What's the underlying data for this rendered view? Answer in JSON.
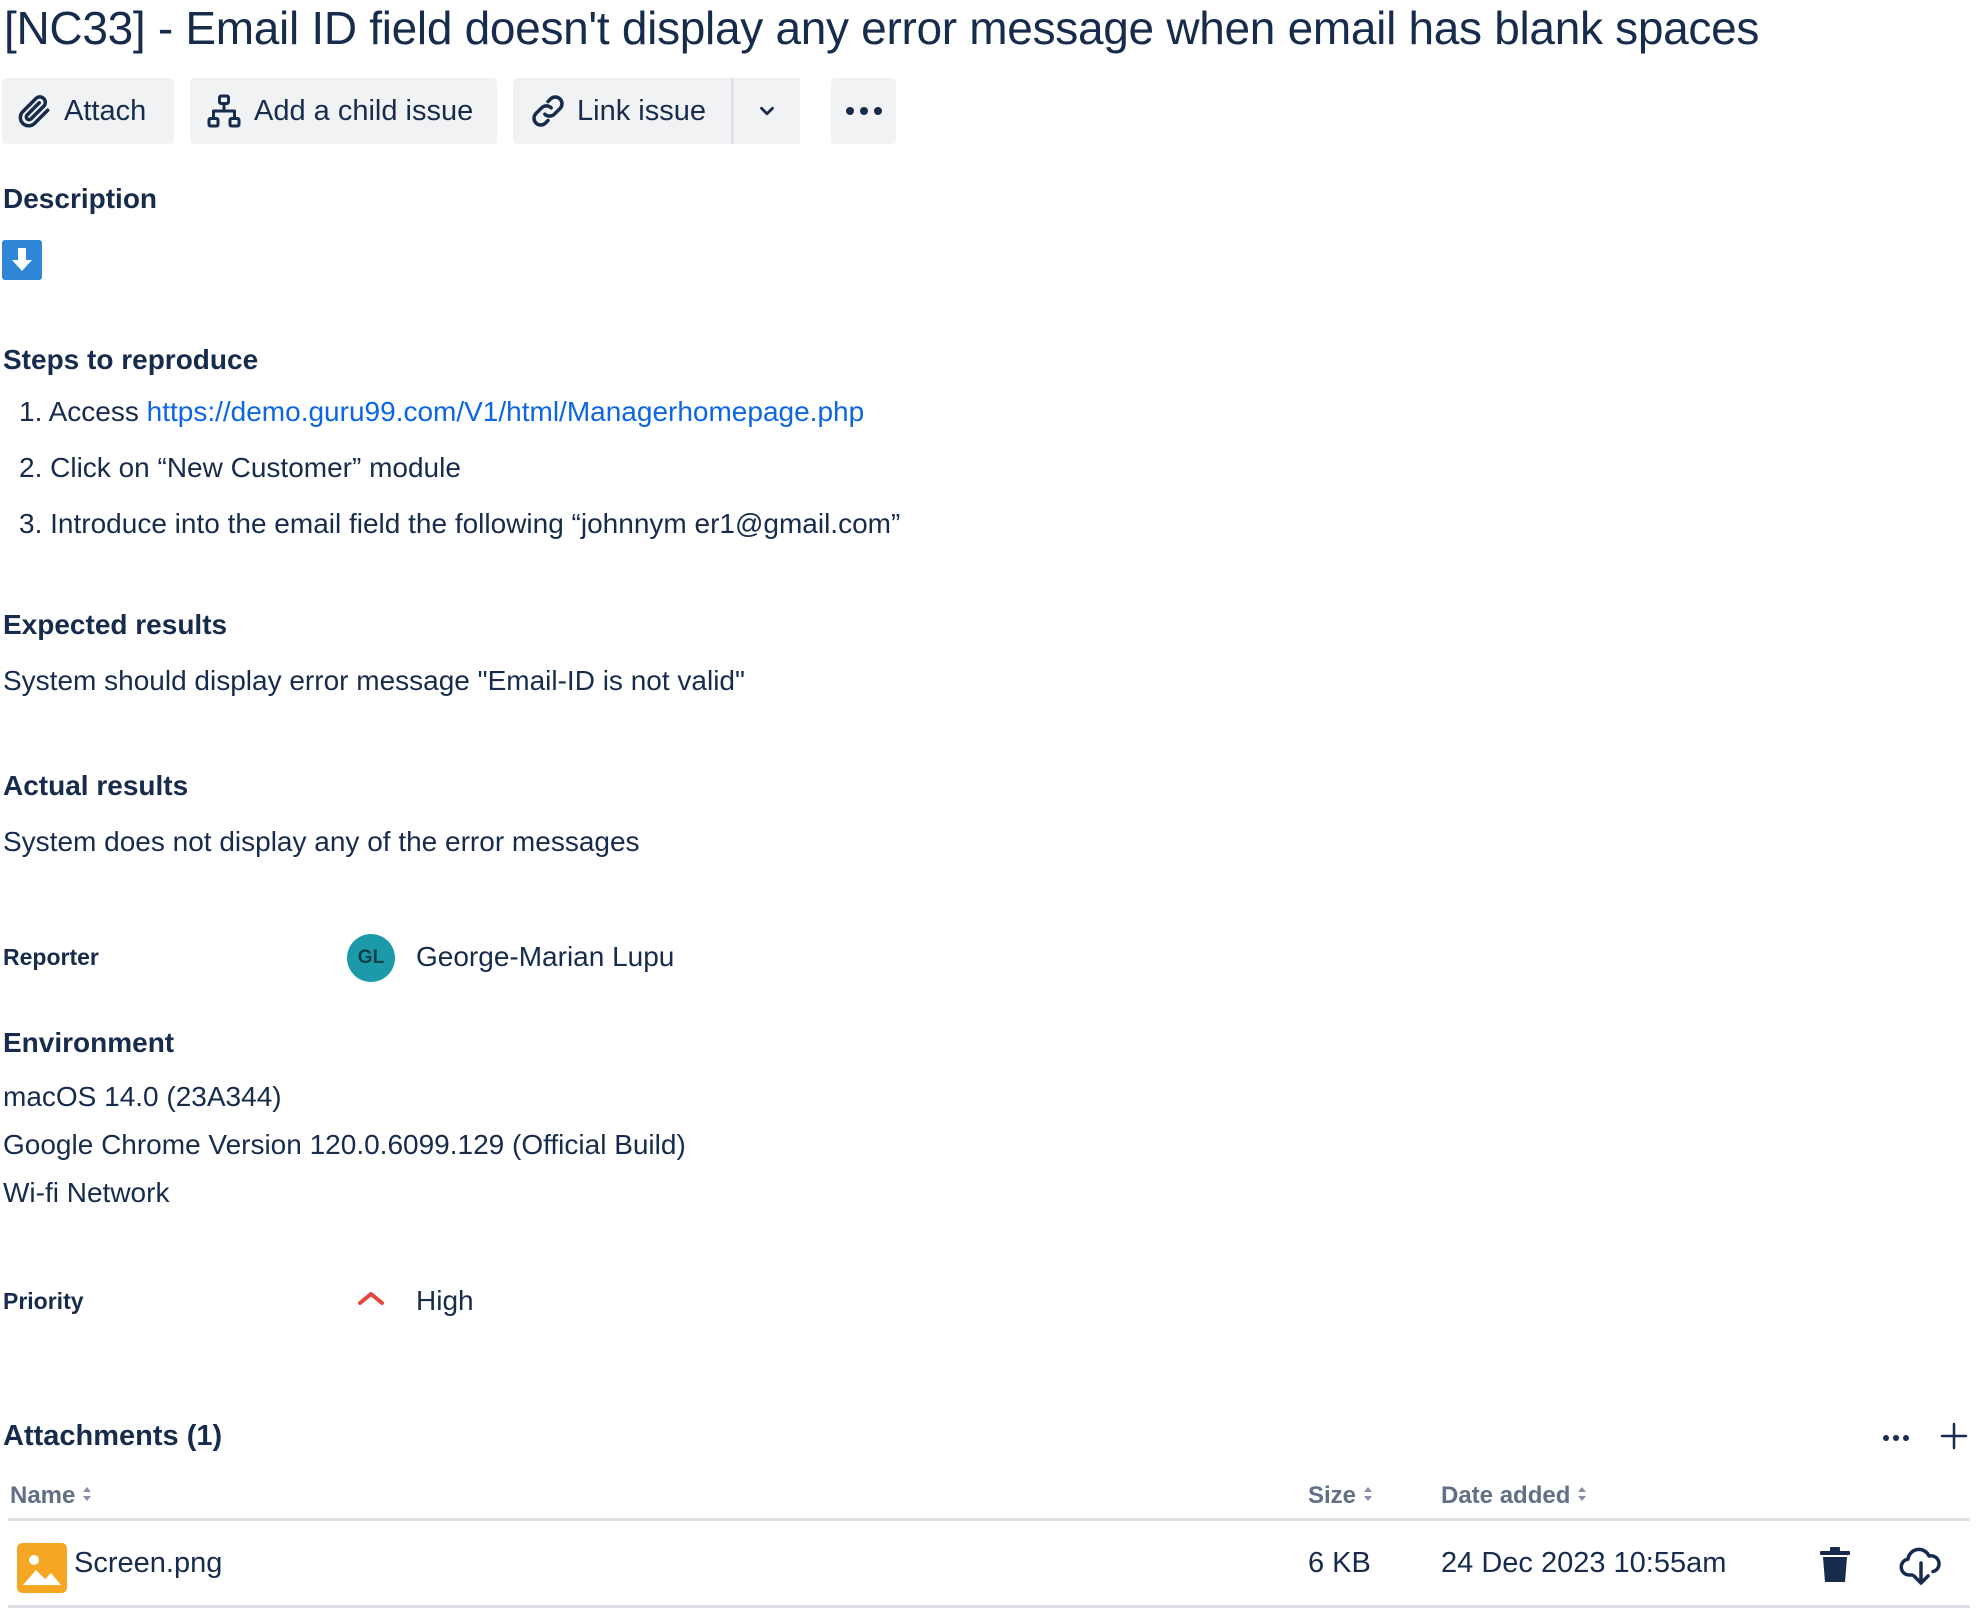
{
  "issue": {
    "title": "[NC33] - Email ID field doesn't display any error message when email has blank spaces"
  },
  "toolbar": {
    "attach_label": "Attach",
    "child_label": "Add a child issue",
    "link_label": "Link issue",
    "icons": [
      "paperclip-icon",
      "hierarchy-icon",
      "link-icon",
      "chevron-down-icon",
      "more-icon"
    ]
  },
  "description": {
    "heading": "Description",
    "steps_heading": "Steps to reproduce",
    "steps": [
      {
        "num": "1.",
        "prefix": "Access ",
        "link": "https://demo.guru99.com/V1/html/Managerhomepage.php"
      },
      {
        "num": "2.",
        "text": "Click on “New Customer” module"
      },
      {
        "num": "3.",
        "text": "Introduce into the email field the following “johnnym er1@gmail.com”"
      }
    ],
    "expected_heading": "Expected results",
    "expected_text": "System should display error message \"Email-ID is not valid\"",
    "actual_heading": "Actual results",
    "actual_text": "System does not display any of the error messages"
  },
  "reporter": {
    "label": "Reporter",
    "initials": "GL",
    "name": "George-Marian Lupu"
  },
  "environment": {
    "heading": "Environment",
    "lines": [
      "macOS 14.0 (23A344)",
      "Google Chrome Version 120.0.6099.129 (Official Build)",
      "Wi-fi Network"
    ]
  },
  "priority": {
    "label": "Priority",
    "value": "High",
    "color": "#e2483d"
  },
  "attachments": {
    "title": "Attachments (1)",
    "columns": {
      "name": "Name",
      "size": "Size",
      "date": "Date added"
    },
    "rows": [
      {
        "name": "Screen.png",
        "size": "6 KB",
        "date": "24 Dec 2023 10:55am"
      }
    ]
  },
  "colors": {
    "link": "#0c66e4",
    "text": "#172b4d",
    "button_bg": "#f1f2f4",
    "avatar_bg": "#1d9aaa",
    "file_icon": "#f5a623"
  }
}
